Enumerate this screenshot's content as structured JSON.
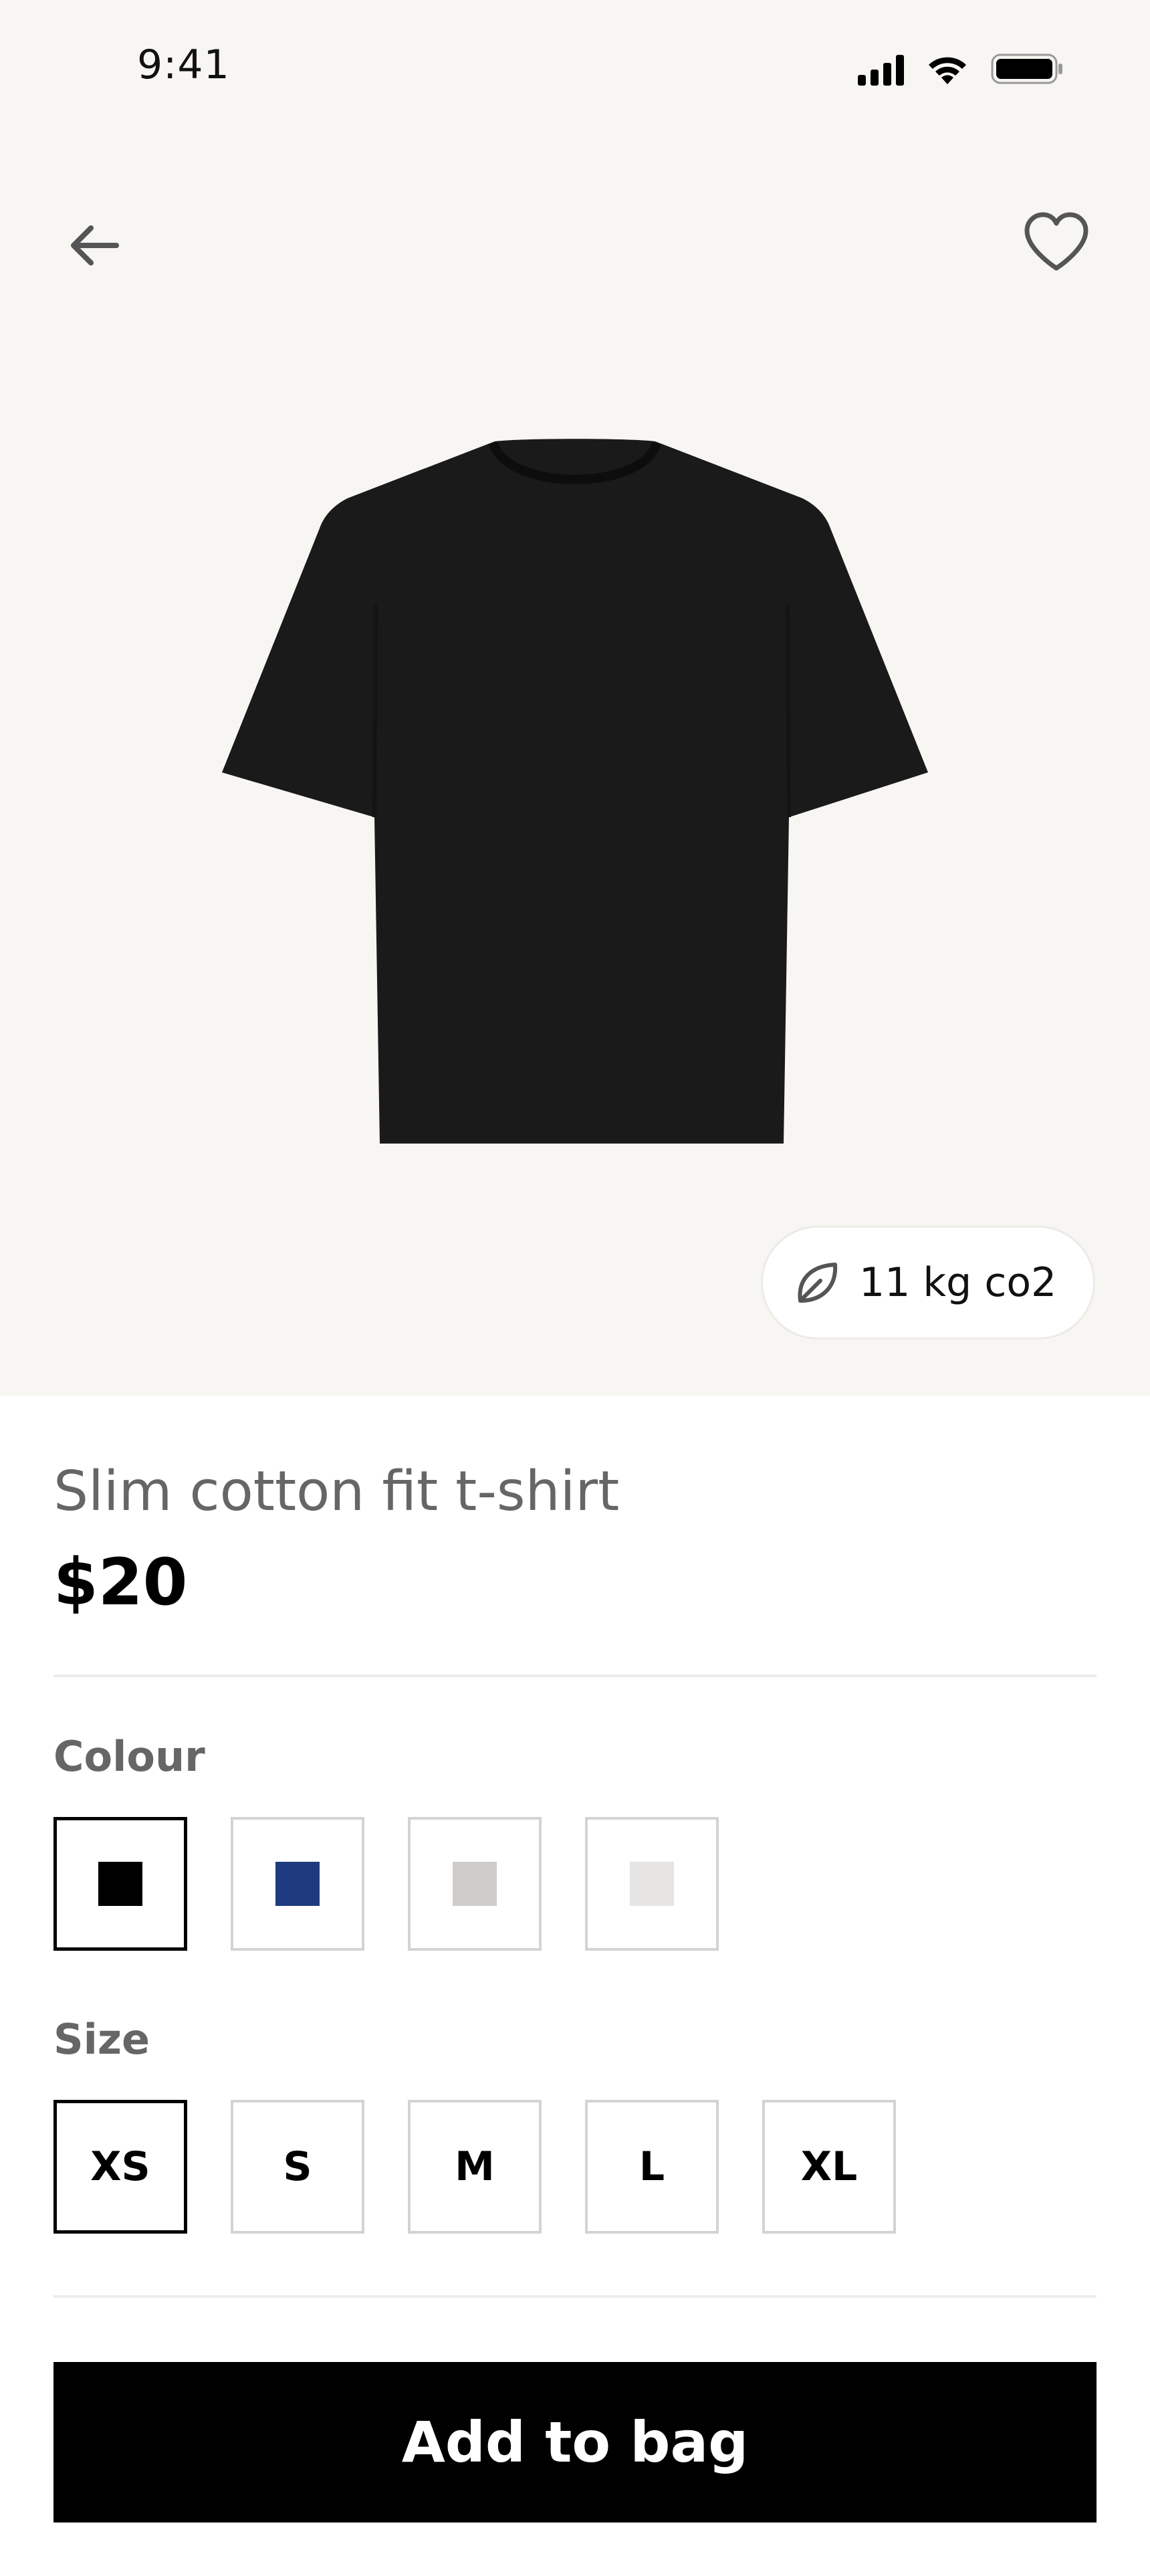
{
  "status_bar": {
    "time": "9:41"
  },
  "icons": {
    "back": "arrow-left-icon",
    "favorite": "heart-icon",
    "co2": "leaf-icon"
  },
  "product": {
    "image_alt": "black t-shirt",
    "co2_label": "11 kg co2",
    "title": "Slim cotton fit t-shirt",
    "price": "$20"
  },
  "colour": {
    "label": "Colour",
    "selected_index": 0,
    "options": [
      {
        "name": "black",
        "hex": "#000000"
      },
      {
        "name": "navy",
        "hex": "#1f3b80"
      },
      {
        "name": "grey",
        "hex": "#cfcdc9"
      },
      {
        "name": "off-white",
        "hex": "#e7e5e3"
      }
    ]
  },
  "size": {
    "label": "Size",
    "selected": "XS",
    "options": [
      "XS",
      "S",
      "M",
      "L",
      "XL"
    ]
  },
  "cta": {
    "label": "Add to bag"
  }
}
